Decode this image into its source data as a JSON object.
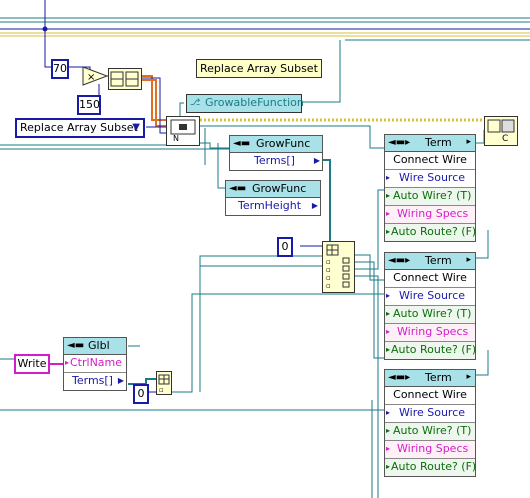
{
  "diagram": {
    "top_label": "Replace Array Subset",
    "const_70": "70",
    "const_150": "150",
    "const_zero_a": "0",
    "const_zero_b": "0",
    "func_ring": "Replace Array Subset",
    "class_const": "GrowableFunction",
    "write_const": "Write",
    "growfunc_terms": {
      "title": "GrowFunc",
      "prop": "Terms[]"
    },
    "growfunc_height": {
      "title": "GrowFunc",
      "prop": "TermHeight"
    },
    "glbl_node": {
      "title": "Glbl",
      "props": [
        "CtrlName",
        "Terms[]"
      ]
    },
    "term_nodes": [
      {
        "title": "Term",
        "method": "Connect Wire",
        "params": [
          "Wire Source",
          "Auto Wire? (T)",
          "Wiring Specs",
          "Auto Route? (F)"
        ]
      },
      {
        "title": "Term",
        "method": "Connect Wire",
        "params": [
          "Wire Source",
          "Auto Wire? (T)",
          "Wiring Specs",
          "Auto Route? (F)"
        ]
      },
      {
        "title": "Term",
        "method": "Connect Wire",
        "params": [
          "Wire Source",
          "Auto Wire? (T)",
          "Wiring Specs",
          "Auto Route? (F)"
        ]
      }
    ],
    "colors": {
      "class_wire": "#1b7b85",
      "number_wire": "#1a1aa8",
      "error_wire": "#d8c23a",
      "string_wire": "#d21ec8",
      "node_header": "#a8e2e8"
    }
  }
}
